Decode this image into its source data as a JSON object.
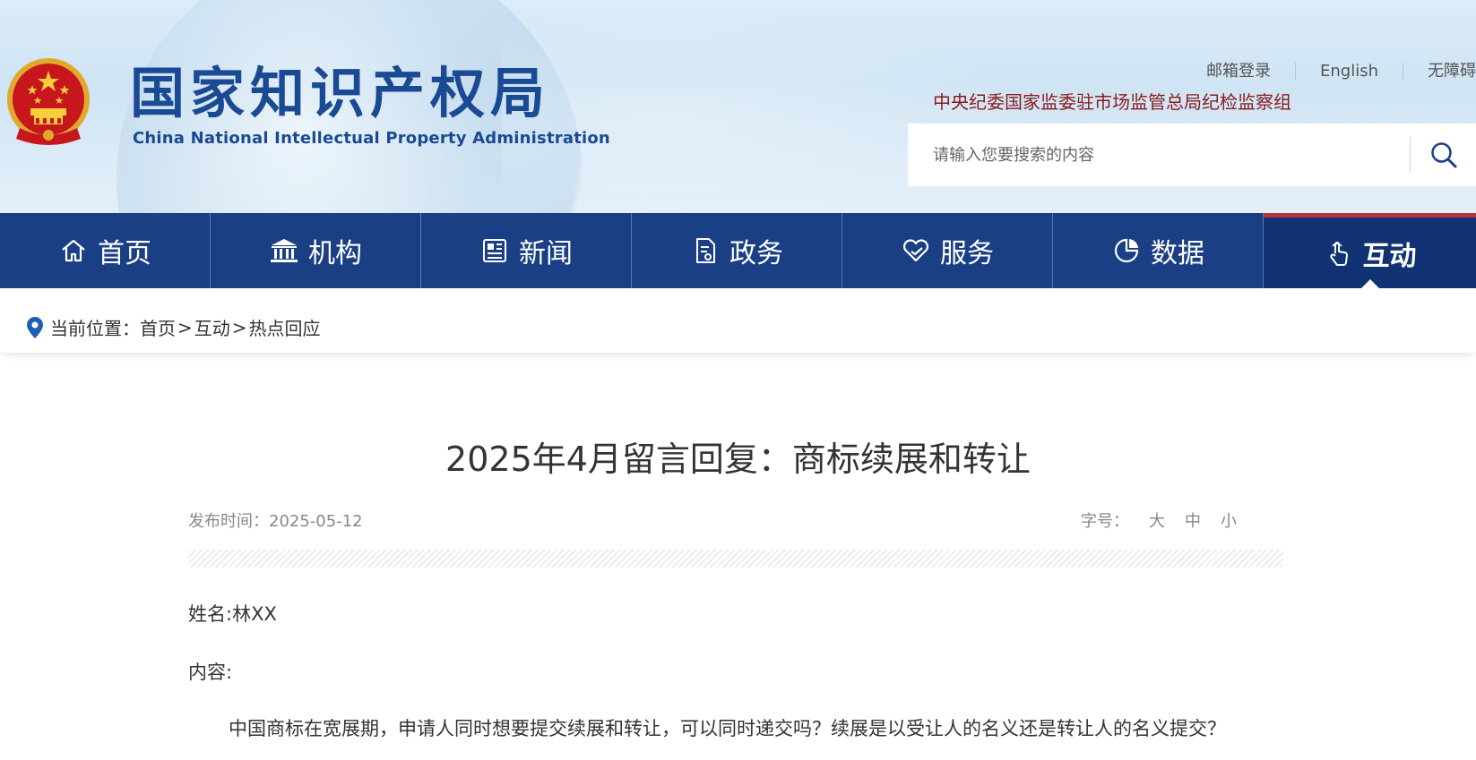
{
  "header": {
    "title_cn": "国家知识产权局",
    "title_en": "China National Intellectual Property Administration",
    "top_links": [
      "邮箱登录",
      "English",
      "无障碍"
    ],
    "org_line": "中央纪委国家监委驻市场监管总局纪检监察组",
    "search_placeholder": "请输入您要搜索的内容",
    "emblem_color": "#c8161d",
    "brand_color": "#1a4a93"
  },
  "nav": {
    "items": [
      {
        "label": "首页",
        "icon": "home-icon"
      },
      {
        "label": "机构",
        "icon": "institution-icon"
      },
      {
        "label": "新闻",
        "icon": "news-icon"
      },
      {
        "label": "政务",
        "icon": "document-icon"
      },
      {
        "label": "服务",
        "icon": "heart-hand-icon"
      },
      {
        "label": "数据",
        "icon": "pie-chart-icon"
      },
      {
        "label": "互动",
        "icon": "pointer-hand-icon",
        "active": true
      }
    ],
    "bg_color": "#1b3f85",
    "active_color": "#123373",
    "active_top_border": "#b9343a"
  },
  "breadcrumb": {
    "prefix": "当前位置：",
    "items": [
      "首页",
      "互动",
      "热点回应"
    ],
    "separator": ">"
  },
  "article": {
    "title": "2025年4月留言回复：商标续展和转让",
    "published": "发布时间：2025-05-12",
    "font_size_label": "字号：",
    "font_sizes": [
      "大",
      "中",
      "小"
    ],
    "name_line": "姓名:林XX",
    "content_label": "内容:",
    "content_text": "中国商标在宽展期，申请人同时想要提交续展和转让，可以同时递交吗？续展是以受让人的名义还是转让人的名义提交？"
  }
}
